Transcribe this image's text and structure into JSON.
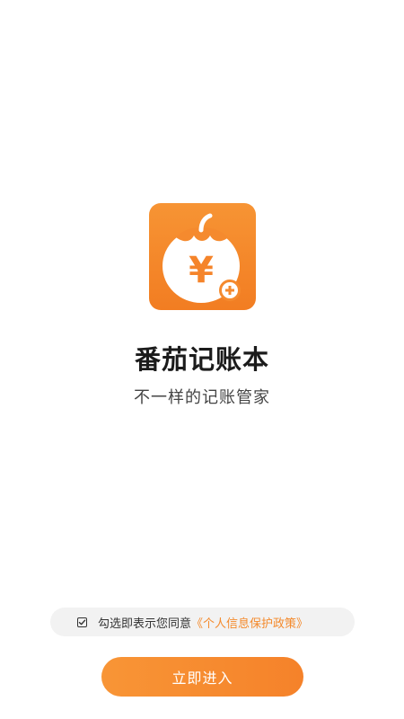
{
  "app": {
    "name": "番茄记账本",
    "slogan": "不一样的记账管家",
    "icon": "tomato-yen-icon",
    "icon_glyph": "¥",
    "brand_color": "#f5842a"
  },
  "agreement": {
    "checked": true,
    "text": "勾选即表示您同意",
    "link_text": "《个人信息保护政策》",
    "link_color": "#f48a2c"
  },
  "actions": {
    "enter_label": "立即进入"
  }
}
